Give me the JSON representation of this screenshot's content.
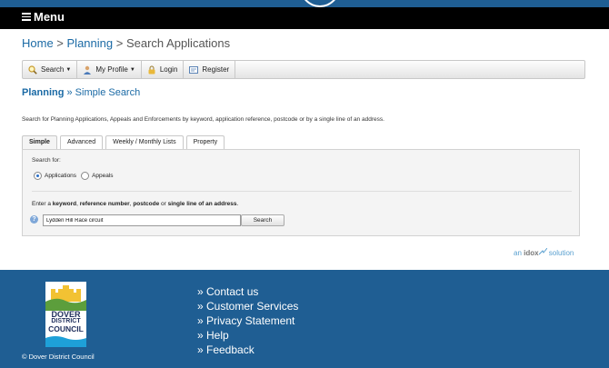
{
  "nav": {
    "menu_label": "Menu"
  },
  "breadcrumb": {
    "home": "Home",
    "sep1": " > ",
    "planning": "Planning",
    "sep2": " > ",
    "current": "Search Applications"
  },
  "toolbar": {
    "search": "Search",
    "my_profile": "My Profile",
    "login": "Login",
    "register": "Register"
  },
  "section": {
    "title_bold": "Planning",
    "title_rest": " » Simple Search"
  },
  "intro": "Search for Planning Applications, Appeals and Enforcements by keyword, application reference, postcode or by a single line of an address.",
  "tabs": [
    {
      "label": "Simple"
    },
    {
      "label": "Advanced"
    },
    {
      "label": "Weekly / Monthly Lists"
    },
    {
      "label": "Property"
    }
  ],
  "search_form": {
    "search_for_label": "Search for:",
    "options": [
      {
        "label": "Applications"
      },
      {
        "label": "Appeals"
      }
    ],
    "instructions": {
      "p1": "Enter a ",
      "b1": "keyword",
      "p2": ", ",
      "b2": "reference number",
      "p3": ", ",
      "b3": "postcode",
      "p4": " or ",
      "b4": "single line of an address",
      "p5": "."
    },
    "input_value": "Lydden Hill Race circuit",
    "search_button": "Search"
  },
  "branding": {
    "idox_pre": "an ",
    "idox_bold": "idox",
    "idox_post": " solution"
  },
  "footer": {
    "logo": {
      "line1": "DOVER",
      "line2": "DISTRICT",
      "line3": "COUNCIL"
    },
    "copyright": "© Dover District Council",
    "links": [
      {
        "label": "» Contact us"
      },
      {
        "label": "» Customer Services"
      },
      {
        "label": "» Privacy Statement"
      },
      {
        "label": "» Help"
      },
      {
        "label": "» Feedback"
      }
    ]
  },
  "colors": {
    "brand_blue": "#1f5e93",
    "link_blue": "#1b6aa5",
    "menubar": "#000000"
  }
}
